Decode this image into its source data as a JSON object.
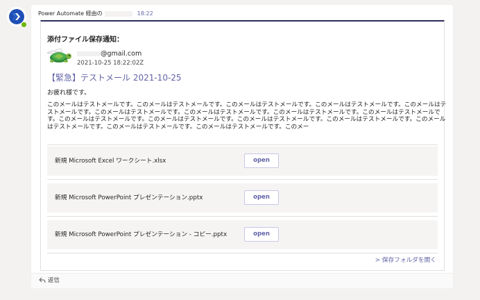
{
  "message": {
    "sender": "Power Automate 経由の",
    "time": "18:22"
  },
  "card": {
    "title": "添付ファイル保存通知：",
    "email": "@gmail.com",
    "date": "2021-10-25 18:22:02Z",
    "subject": "【緊急】テストメール 2021-10-25",
    "greeting": "お疲れ様です。",
    "body": "このメールはテストメールです。このメールはテストメールです。このメールはテストメールです。このメールはテストメールです。このメールはテストメールです。このメールはテストメールです。このメールはテストメールです。このメールはテストメールです。このメールはテストメールです。このメールはテストメールです。このメールはテストメールです。このメールはテストメールです。このメールはテストメールです。このメールはテストメールです。このメールはテストメールです。このメールはテストメールです。このメー",
    "files": [
      {
        "name": "新規 Microsoft Excel ワークシート.xlsx",
        "button": "open"
      },
      {
        "name": "新規 Microsoft PowerPoint プレゼンテーション.pptx",
        "button": "open"
      },
      {
        "name": "新規 Microsoft PowerPoint プレゼンテーション - コピー.pptx",
        "button": "open"
      }
    ],
    "open_folder": "> 保存フォルダを開く"
  },
  "reply_label": "返信",
  "colors": {
    "accent": "#6264a7",
    "header_rule": "#2c2d5a",
    "file_row_bg": "#f5f4f3",
    "presence": "#6bb700"
  }
}
